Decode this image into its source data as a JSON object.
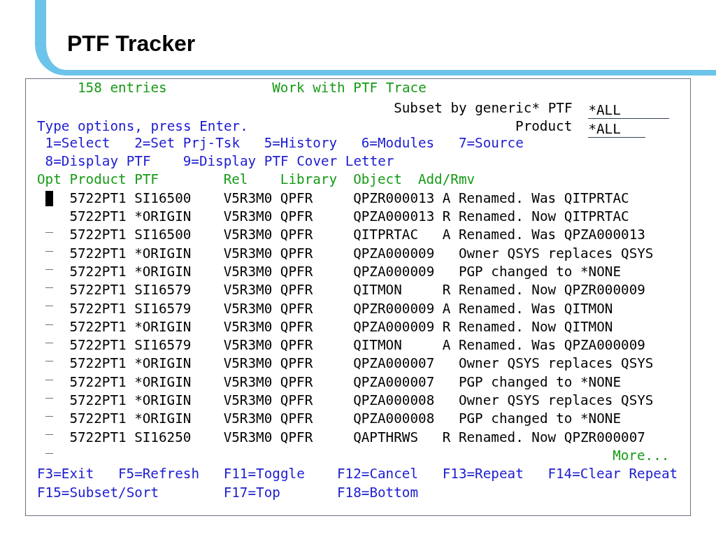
{
  "slide": {
    "title": "PTF Tracker"
  },
  "screen": {
    "entry_count": "158 entries",
    "title": "Work with PTF Trace",
    "filters": [
      {
        "label": "Subset by generic* PTF",
        "value": "*ALL"
      },
      {
        "label": "Product",
        "value": "*ALL"
      }
    ],
    "instructions": "Type options, press Enter.",
    "options": [
      [
        "1=Select",
        "2=Set Prj-Tsk",
        "5=History",
        "6=Modules",
        "7=Source"
      ],
      [
        "8=Display PTF",
        "9=Display PTF Cover Letter"
      ]
    ],
    "columns": [
      "Opt",
      "Product",
      "PTF",
      "Rel",
      "Library",
      "Object",
      "Add/Rmv"
    ],
    "rows": [
      {
        "cursor": true,
        "product": "5722PT1",
        "ptf": "SI16500",
        "rel": "V5R3M0",
        "library": "QPFR",
        "object": "QPZR000013",
        "add_rmv": "A",
        "description": "Renamed. Was QITPRTAC"
      },
      {
        "cursor": false,
        "product": "5722PT1",
        "ptf": "*ORIGIN",
        "rel": "V5R3M0",
        "library": "QPFR",
        "object": "QPZA000013",
        "add_rmv": "R",
        "description": "Renamed. Now QITPRTAC"
      },
      {
        "cursor": false,
        "product": "5722PT1",
        "ptf": "SI16500",
        "rel": "V5R3M0",
        "library": "QPFR",
        "object": "QITPRTAC",
        "add_rmv": "A",
        "description": "Renamed. Was QPZA000013"
      },
      {
        "cursor": false,
        "product": "5722PT1",
        "ptf": "*ORIGIN",
        "rel": "V5R3M0",
        "library": "QPFR",
        "object": "QPZA000009",
        "description": "Owner QSYS replaces QSYS"
      },
      {
        "cursor": false,
        "product": "5722PT1",
        "ptf": "*ORIGIN",
        "rel": "V5R3M0",
        "library": "QPFR",
        "object": "QPZA000009",
        "description": "PGP changed to *NONE"
      },
      {
        "cursor": false,
        "product": "5722PT1",
        "ptf": "SI16579",
        "rel": "V5R3M0",
        "library": "QPFR",
        "object": "QITMON",
        "add_rmv": "R",
        "description": "Renamed. Now QPZR000009"
      },
      {
        "cursor": false,
        "product": "5722PT1",
        "ptf": "SI16579",
        "rel": "V5R3M0",
        "library": "QPFR",
        "object": "QPZR000009",
        "add_rmv": "A",
        "description": "Renamed. Was QITMON"
      },
      {
        "cursor": false,
        "product": "5722PT1",
        "ptf": "*ORIGIN",
        "rel": "V5R3M0",
        "library": "QPFR",
        "object": "QPZA000009",
        "add_rmv": "R",
        "description": "Renamed. Now QITMON"
      },
      {
        "cursor": false,
        "product": "5722PT1",
        "ptf": "SI16579",
        "rel": "V5R3M0",
        "library": "QPFR",
        "object": "QITMON",
        "add_rmv": "A",
        "description": "Renamed. Was QPZA000009"
      },
      {
        "cursor": false,
        "product": "5722PT1",
        "ptf": "*ORIGIN",
        "rel": "V5R3M0",
        "library": "QPFR",
        "object": "QPZA000007",
        "description": "Owner QSYS replaces QSYS"
      },
      {
        "cursor": false,
        "product": "5722PT1",
        "ptf": "*ORIGIN",
        "rel": "V5R3M0",
        "library": "QPFR",
        "object": "QPZA000007",
        "description": "PGP changed to *NONE"
      },
      {
        "cursor": false,
        "product": "5722PT1",
        "ptf": "*ORIGIN",
        "rel": "V5R3M0",
        "library": "QPFR",
        "object": "QPZA000008",
        "description": "Owner QSYS replaces QSYS"
      },
      {
        "cursor": false,
        "product": "5722PT1",
        "ptf": "*ORIGIN",
        "rel": "V5R3M0",
        "library": "QPFR",
        "object": "QPZA000008",
        "description": "PGP changed to *NONE"
      },
      {
        "cursor": false,
        "product": "5722PT1",
        "ptf": "SI16250",
        "rel": "V5R3M0",
        "library": "QPFR",
        "object": "QAPTHRWS",
        "add_rmv": "R",
        "description": "Renamed. Now QPZR000007"
      }
    ],
    "more": "More...",
    "function_keys": [
      [
        "F3=Exit",
        "F5=Refresh",
        "F11=Toggle",
        "F12=Cancel",
        "F13=Repeat",
        "F14=Clear Repeat"
      ],
      [
        "F15=Subset/Sort",
        "F17=Top",
        "F18=Bottom"
      ]
    ]
  }
}
